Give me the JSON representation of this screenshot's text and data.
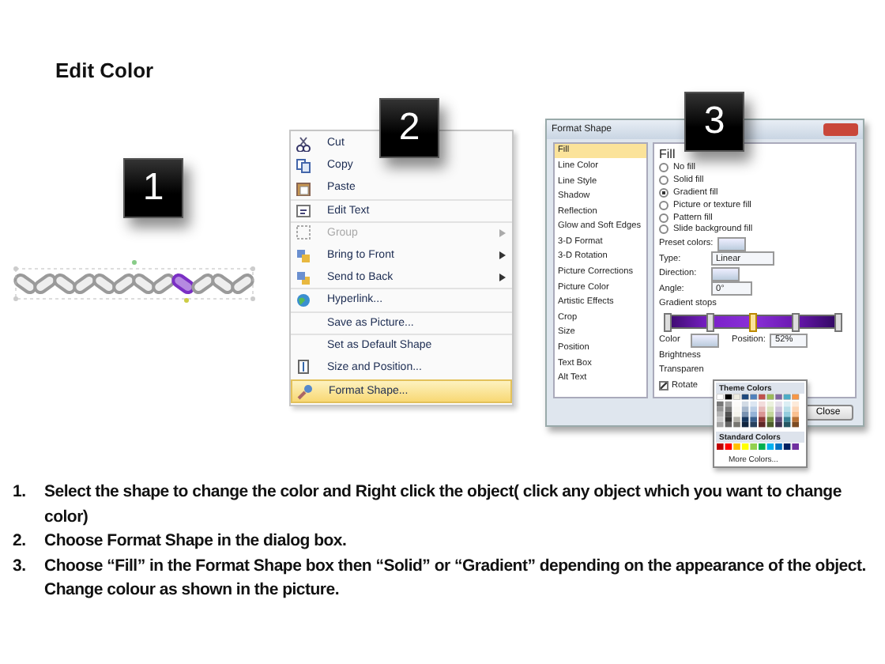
{
  "title": "Edit Color",
  "step_1": {
    "badge": "1"
  },
  "context_menu": {
    "badge": "2",
    "items": [
      {
        "label": "Cut",
        "disabled": false,
        "submenu": false,
        "selected": false
      },
      {
        "label": "Copy",
        "disabled": false,
        "submenu": false,
        "selected": false
      },
      {
        "label": "Paste",
        "disabled": false,
        "submenu": false,
        "selected": false
      },
      {
        "label": "Edit Text",
        "disabled": false,
        "submenu": false,
        "selected": false
      },
      {
        "label": "Group",
        "disabled": true,
        "submenu": true,
        "selected": false
      },
      {
        "label": "Bring to Front",
        "disabled": false,
        "submenu": true,
        "selected": false
      },
      {
        "label": "Send to Back",
        "disabled": false,
        "submenu": true,
        "selected": false
      },
      {
        "label": "Hyperlink...",
        "disabled": false,
        "submenu": false,
        "selected": false
      },
      {
        "label": "Save as Picture...",
        "disabled": false,
        "submenu": false,
        "selected": false
      },
      {
        "label": "Set as Default Shape",
        "disabled": false,
        "submenu": false,
        "selected": false
      },
      {
        "label": "Size and Position...",
        "disabled": false,
        "submenu": false,
        "selected": false
      },
      {
        "label": "Format Shape...",
        "disabled": false,
        "submenu": false,
        "selected": true
      }
    ]
  },
  "format_shape_dialog": {
    "badge": "3",
    "title": "Format Shape",
    "categories": [
      {
        "label": "Fill",
        "selected": true
      },
      {
        "label": "Line Color",
        "selected": false
      },
      {
        "label": "Line Style",
        "selected": false
      },
      {
        "label": "Shadow",
        "selected": false
      },
      {
        "label": "Reflection",
        "selected": false
      },
      {
        "label": "Glow and Soft Edges",
        "selected": false
      },
      {
        "label": "3-D Format",
        "selected": false
      },
      {
        "label": "3-D Rotation",
        "selected": false
      },
      {
        "label": "Picture Corrections",
        "selected": false
      },
      {
        "label": "Picture Color",
        "selected": false
      },
      {
        "label": "Artistic Effects",
        "selected": false
      },
      {
        "label": "Crop",
        "selected": false
      },
      {
        "label": "Size",
        "selected": false
      },
      {
        "label": "Position",
        "selected": false
      },
      {
        "label": "Text Box",
        "selected": false
      },
      {
        "label": "Alt Text",
        "selected": false
      }
    ],
    "heading": "Fill",
    "fill_options": [
      {
        "label": "No fill",
        "selected": false
      },
      {
        "label": "Solid fill",
        "selected": false
      },
      {
        "label": "Gradient fill",
        "selected": true
      },
      {
        "label": "Picture or texture fill",
        "selected": false
      },
      {
        "label": "Pattern fill",
        "selected": false
      },
      {
        "label": "Slide background fill",
        "selected": false
      }
    ],
    "preset_colors_label": "Preset colors:",
    "type_label": "Type:",
    "type_value": "Linear",
    "direction_label": "Direction:",
    "angle_label": "Angle:",
    "angle_value": "0°",
    "gradient_stops_label": "Gradient stops",
    "gradient_stops": [
      {
        "level": 0,
        "selected": false
      },
      {
        "level": 0.25,
        "selected": false
      },
      {
        "level": 0.5,
        "selected": true
      },
      {
        "level": 0.75,
        "selected": false
      },
      {
        "level": 1,
        "selected": false
      }
    ],
    "color_label": "Color",
    "position_label": "Position:",
    "position_value": "52%",
    "brightness_label": "Brightness",
    "transparency_label": "Transparen",
    "rotate_label": "Rotate",
    "rotate_checked": true,
    "close_button": "Close",
    "color_picker": {
      "theme_label": "Theme Colors",
      "standard_label": "Standard Colors",
      "more_colors": "More Colors..."
    }
  },
  "instructions": [
    {
      "number": "1.",
      "text": "Select the shape to change the color and Right click the object( click any object which you want to change color)"
    },
    {
      "number": "2.",
      "text": "Choose Format Shape in the dialog box."
    },
    {
      "number": "3.",
      "text": "Choose “Fill” in the Format Shape box then “Solid” or “Gradient” depending on the appearance of the object. Change colour as shown in the picture."
    }
  ]
}
